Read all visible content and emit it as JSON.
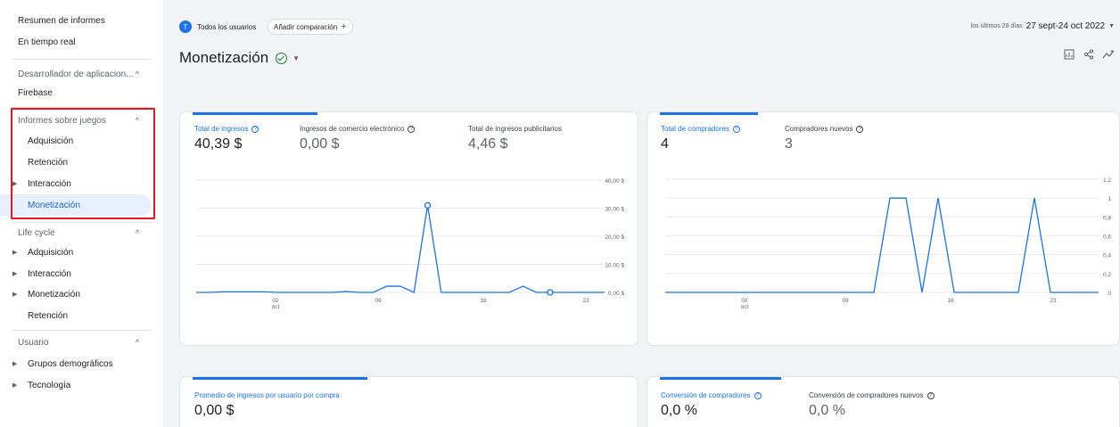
{
  "sidebar": {
    "top_items": [
      "Resumen de informes",
      "En tiempo real"
    ],
    "sections": [
      {
        "title": "Desarrollador de aplicacion...",
        "items": [
          {
            "label": "Firebase",
            "expandable": false
          }
        ]
      },
      {
        "title": "Informes sobre juegos",
        "items": [
          {
            "label": "Adquisición",
            "expandable": false
          },
          {
            "label": "Retención",
            "expandable": false
          },
          {
            "label": "Interacción",
            "expandable": true
          },
          {
            "label": "Monetización",
            "expandable": false,
            "active": true
          }
        ]
      },
      {
        "title": "Life cycle",
        "items": [
          {
            "label": "Adquisición",
            "expandable": true
          },
          {
            "label": "Interacción",
            "expandable": true
          },
          {
            "label": "Monetización",
            "expandable": true
          },
          {
            "label": "Retención",
            "expandable": false
          }
        ]
      },
      {
        "title": "Usuario",
        "items": [
          {
            "label": "Grupos demográficos",
            "expandable": true
          },
          {
            "label": "Tecnología",
            "expandable": true
          }
        ]
      }
    ]
  },
  "topbar": {
    "segment_initial": "T",
    "segment_label": "Todos los usuarios",
    "compare_label": "Añadir comparación",
    "date_prefix": "los últimos 28 días",
    "date_range": "27 sept-24 oct 2022"
  },
  "page": {
    "title": "Monetización"
  },
  "cards": {
    "revenue": {
      "metrics": [
        {
          "label": "Total de ingresos",
          "value": "40,39 $"
        },
        {
          "label": "Ingresos de comercio electrónico",
          "value": "0,00 $"
        },
        {
          "label": "Total de ingresos publicitarios",
          "value": "4,46 $"
        }
      ]
    },
    "buyers": {
      "metrics": [
        {
          "label": "Total de compradores",
          "value": "4"
        },
        {
          "label": "Compradores nuevos",
          "value": "3"
        }
      ]
    },
    "arppu": {
      "metrics": [
        {
          "label": "Promedio de ingresos por usuario por compra",
          "value": "0,00 $"
        }
      ]
    },
    "conversion": {
      "metrics": [
        {
          "label": "Conversión de compradores",
          "value": "0,0 %"
        },
        {
          "label": "Conversión de compradores nuevos",
          "value": "0,0 %"
        }
      ]
    }
  },
  "chart_data": [
    {
      "type": "line",
      "x_tick_labels": [
        "02\noct",
        "09",
        "16",
        "23"
      ],
      "y_tick_labels": [
        "40,00 $",
        "30,00 $",
        "20,00 $",
        "10,00 $",
        "0,00 $"
      ],
      "ylim": [
        0,
        40
      ],
      "x": [
        "27 sept",
        "28 sept",
        "29 sept",
        "30 sept",
        "1 oct",
        "2 oct",
        "3 oct",
        "4 oct",
        "5 oct",
        "6 oct",
        "7 oct",
        "8 oct",
        "9 oct",
        "10 oct",
        "11 oct",
        "12 oct",
        "13 oct",
        "14 oct",
        "15 oct",
        "16 oct",
        "17 oct",
        "18 oct",
        "19 oct",
        "20 oct",
        "21 oct",
        "22 oct",
        "23 oct",
        "24 oct"
      ],
      "series": [
        {
          "values": [
            0,
            0,
            0.2,
            0.2,
            0.2,
            0.2,
            0,
            0,
            0,
            0,
            0,
            0.3,
            0,
            0,
            2.2,
            2.2,
            0,
            31,
            0,
            0,
            0,
            0,
            0,
            0,
            2.2,
            0,
            0,
            0,
            0,
            0,
            0
          ]
        }
      ],
      "markers": [
        {
          "x_index": 17,
          "value": 31
        },
        {
          "x_index": 26,
          "value": 0
        }
      ],
      "color": "#1a73e8",
      "grid": true
    },
    {
      "type": "line",
      "x_tick_labels": [
        "02\noct",
        "09",
        "16",
        "23"
      ],
      "y_tick_labels": [
        "1,2",
        "1",
        "0,8",
        "0,6",
        "0,4",
        "0,2",
        "0"
      ],
      "ylim": [
        0,
        1.2
      ],
      "x": [
        "27 sept",
        "28 sept",
        "29 sept",
        "30 sept",
        "1 oct",
        "2 oct",
        "3 oct",
        "4 oct",
        "5 oct",
        "6 oct",
        "7 oct",
        "8 oct",
        "9 oct",
        "10 oct",
        "11 oct",
        "12 oct",
        "13 oct",
        "14 oct",
        "15 oct",
        "16 oct",
        "17 oct",
        "18 oct",
        "19 oct",
        "20 oct",
        "21 oct",
        "22 oct",
        "23 oct",
        "24 oct"
      ],
      "series": [
        {
          "values": [
            0,
            0,
            0,
            0,
            0,
            0,
            0,
            0,
            0,
            0,
            0,
            0,
            0,
            0,
            1,
            1,
            0,
            1,
            0,
            0,
            0,
            0,
            0,
            1,
            0,
            0,
            0,
            0
          ]
        }
      ],
      "color": "#1a73e8",
      "grid": true
    }
  ]
}
